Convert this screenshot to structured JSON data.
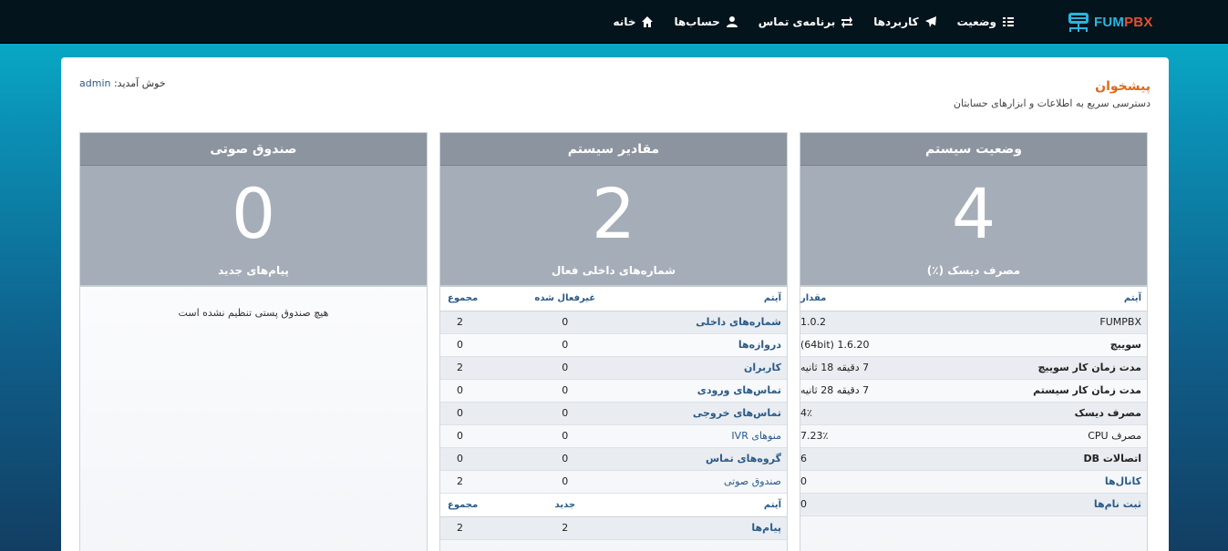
{
  "brand": {
    "fum": "FUM",
    "pbx": "PBX"
  },
  "nav": [
    {
      "label": "خانه",
      "icon": "home-icon"
    },
    {
      "label": "حساب‌ها",
      "icon": "user-icon"
    },
    {
      "label": "برنامه‌ی تماس",
      "icon": "exchange-icon"
    },
    {
      "label": "کاربردها",
      "icon": "send-icon"
    },
    {
      "label": "وضعیت",
      "icon": "bar-chart-icon"
    }
  ],
  "header": {
    "welcome_label": "خوش آمدید:",
    "username": "admin",
    "title": "پیشخوان",
    "subtitle": "دسترسی سریع به اطلاعات و ابزارهای حسابتان"
  },
  "panels": {
    "system_status": {
      "title": "وضعیت سیستم",
      "stat": "4",
      "stat_label": "مصرف دیسک (٪)",
      "col_item": "آیتم",
      "col_value": "مقدار",
      "rows": [
        {
          "name": "FUMPBX",
          "value": "1.0.2"
        },
        {
          "name": "سوییچ",
          "value": "1.6.20 (64bit)"
        },
        {
          "name": "مدت زمان کار سوییچ",
          "value": "7 دقیقه 18 ثانیه"
        },
        {
          "name": "مدت زمان کار سیستم",
          "value": "7 دقیقه 28 ثانیه"
        },
        {
          "name": "مصرف دیسک",
          "value": "4٪"
        },
        {
          "name": "مصرف CPU",
          "value": "7.23٪"
        },
        {
          "name": "اتصالات DB",
          "value": "6"
        },
        {
          "name": "کانال‌ها",
          "value": "0"
        },
        {
          "name": "ثبت نام‌ها",
          "value": "0"
        }
      ]
    },
    "system_values": {
      "title": "مقادیر سیستم",
      "stat": "2",
      "stat_label": "شماره‌های داخلی فعال",
      "col_item": "آیتم",
      "col_disabled": "غیرفعال شده",
      "col_total": "مجموع",
      "rows": [
        {
          "name": "شماره‌های داخلی",
          "disabled": "0",
          "total": "2"
        },
        {
          "name": "دروازه‌ها",
          "disabled": "0",
          "total": "0"
        },
        {
          "name": "کاربران",
          "disabled": "0",
          "total": "2"
        },
        {
          "name": "تماس‌های ورودی",
          "disabled": "0",
          "total": "0"
        },
        {
          "name": "تماس‌های خروجی",
          "disabled": "0",
          "total": "0"
        },
        {
          "name": "منوهای IVR",
          "disabled": "0",
          "total": "0"
        },
        {
          "name": "گروه‌های تماس",
          "disabled": "0",
          "total": "0"
        },
        {
          "name": "صندوق صوتی",
          "disabled": "0",
          "total": "2"
        }
      ],
      "col_item2": "آیتم",
      "col_new": "جدید",
      "col_total2": "مجموع",
      "rows2": [
        {
          "name": "پیام‌ها",
          "new": "2",
          "total": "2"
        }
      ]
    },
    "voicemail": {
      "title": "صندوق صوتی",
      "stat": "0",
      "stat_label": "پیام‌های جدید",
      "empty_message": "هیچ صندوق پستی تنظیم نشده است"
    }
  }
}
